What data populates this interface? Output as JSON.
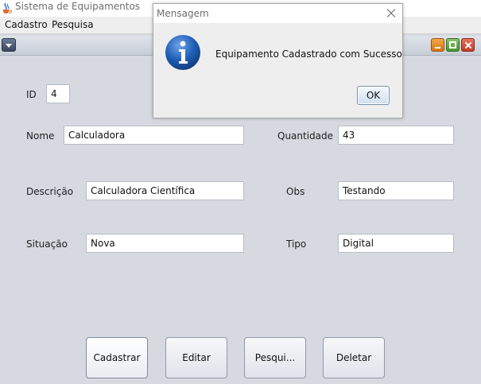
{
  "window": {
    "title": "Sistema de Equipamentos",
    "icon": "java-coffee-icon"
  },
  "menubar": {
    "items": [
      "Cadastro",
      "Pesquisa"
    ]
  },
  "internal_frame": {
    "buttons": [
      "menu-icon",
      "minimize-icon",
      "maximize-icon",
      "close-icon"
    ],
    "colors": {
      "minimize": "#e48c2a",
      "maximize": "#6aae4a",
      "close": "#d5553e"
    }
  },
  "form": {
    "id": {
      "label": "ID",
      "value": "4"
    },
    "nome": {
      "label": "Nome",
      "value": "Calculadora"
    },
    "quantidade": {
      "label": "Quantidade",
      "value": "43"
    },
    "descricao": {
      "label": "Descrição",
      "value": "Calculadora Científica"
    },
    "obs": {
      "label": "Obs",
      "value": "Testando"
    },
    "situacao": {
      "label": "Situação",
      "value": "Nova"
    },
    "tipo": {
      "label": "Tipo",
      "value": "Digital"
    }
  },
  "actions": {
    "cadastrar": "Cadastrar",
    "editar": "Editar",
    "pesquisar": "Pesqui...",
    "deletar": "Deletar"
  },
  "dialog": {
    "title": "Mensagem",
    "message": "Equipamento Cadastrado com Sucesso",
    "ok": "OK",
    "icon": "info-icon",
    "icon_color": "#1f5fb8"
  }
}
